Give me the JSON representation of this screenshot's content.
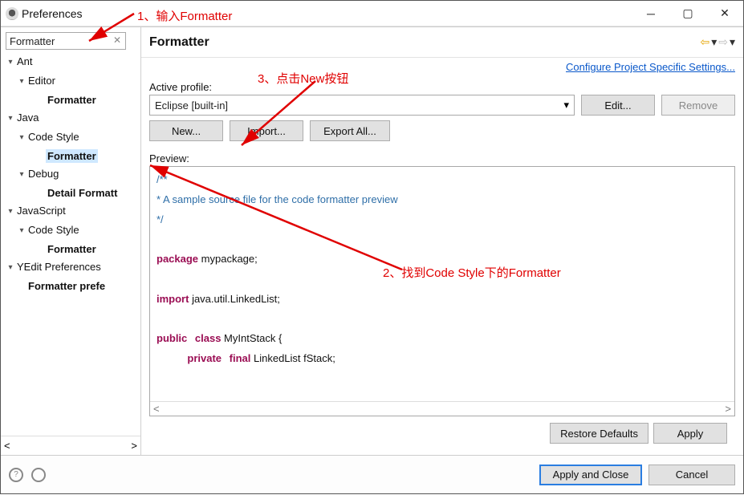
{
  "window": {
    "title": "Preferences"
  },
  "search": {
    "value": "Formatter"
  },
  "tree": [
    {
      "lvl": 1,
      "arrow": "▾",
      "label": "Ant"
    },
    {
      "lvl": 2,
      "arrow": "▾",
      "label": "Editor"
    },
    {
      "lvl": 3,
      "arrow": "",
      "label": "Formatter",
      "bold": true
    },
    {
      "lvl": 1,
      "arrow": "▾",
      "label": "Java"
    },
    {
      "lvl": 2,
      "arrow": "▾",
      "label": "Code Style"
    },
    {
      "lvl": 3,
      "arrow": "",
      "label": "Formatter",
      "bold": true,
      "selected": true
    },
    {
      "lvl": 2,
      "arrow": "▾",
      "label": "Debug"
    },
    {
      "lvl": 3,
      "arrow": "",
      "label": "Detail Formatt",
      "bold": true
    },
    {
      "lvl": 1,
      "arrow": "▾",
      "label": "JavaScript"
    },
    {
      "lvl": 2,
      "arrow": "▾",
      "label": "Code Style"
    },
    {
      "lvl": 3,
      "arrow": "",
      "label": "Formatter",
      "bold": true
    },
    {
      "lvl": 1,
      "arrow": "▾",
      "label": "YEdit Preferences"
    },
    {
      "lvl": 2,
      "arrow": "",
      "label": "Formatter prefe",
      "bold": true
    }
  ],
  "header": {
    "title": "Formatter"
  },
  "link": "Configure Project Specific Settings...",
  "labels": {
    "activeProfile": "Active profile:",
    "preview": "Preview:"
  },
  "combo": {
    "activeProfile": "Eclipse [built-in]"
  },
  "buttons": {
    "edit": "Edit...",
    "remove": "Remove",
    "new": "New...",
    "import": "Import...",
    "exportAll": "Export All...",
    "restoreDefaults": "Restore Defaults",
    "apply": "Apply",
    "applyAndClose": "Apply and Close",
    "cancel": "Cancel"
  },
  "code": {
    "l1": "/**",
    "l2": "* A sample source file for the code formatter preview",
    "l3": "*/",
    "l4": "",
    "kw_package": "package",
    "pkgname": " mypackage;",
    "kw_import": "import",
    "impname": " java.util.LinkedList;",
    "kw_public": "public",
    "kw_class": "class",
    "clsname": " MyIntStack {",
    "kw_private": "private",
    "kw_final": "final",
    "fld": " LinkedList fStack;"
  },
  "annotations": {
    "a1": "1、输入Formatter",
    "a2": "2、找到Code Style下的Formatter",
    "a3": "3、点击New按钮"
  }
}
